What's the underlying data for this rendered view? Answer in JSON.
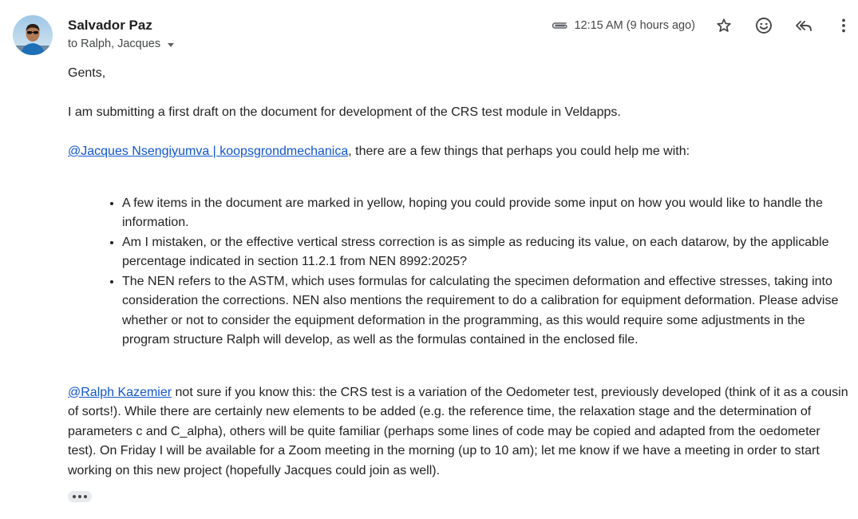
{
  "sender": {
    "name": "Salvador Paz",
    "recipients": "to Ralph, Jacques"
  },
  "meta": {
    "timestamp": "12:15 AM (9 hours ago)"
  },
  "icons": {
    "attachment": "paperclip-icon",
    "star": "star-icon",
    "emoji": "emoji-reaction-icon",
    "reply_all": "reply-all-icon",
    "more": "more-vert-icon",
    "caret": "chevron-down-icon",
    "expand": "ellipsis-icon"
  },
  "colors": {
    "link": "#1155cc",
    "text": "#222222",
    "secondary": "#444746",
    "icon": "#444746"
  },
  "body": {
    "greeting": "Gents,",
    "paragraph1": "I am submitting a first draft on the document for development of the CRS test module in Veldapps.",
    "mention1": "@Jacques Nsengiyumva | koopsgrondmechanica",
    "paragraph2_rest": ", there are a few things that perhaps you could help me with:",
    "bullets": [
      "A few items in the document are marked in yellow, hoping you could provide some input on how you would like to handle the information.",
      "Am I mistaken, or the effective vertical stress correction is as simple as reducing its value, on each datarow, by the applicable percentage indicated in section 11.2.1 from NEN 8992:2025?",
      "The NEN refers to the ASTM, which uses formulas for calculating the specimen deformation and effective stresses, taking into consideration the corrections. NEN also mentions the requirement to do a calibration for equipment deformation. Please advise whether or not to consider the equipment deformation in the programming, as this would require some adjustments in the program structure Ralph will develop, as well as the formulas contained in the enclosed file."
    ],
    "mention2": "@Ralph Kazemier",
    "paragraph3_rest": " not sure if you know this: the CRS test is a variation of the Oedometer test, previously developed (think of it as a cousin of sorts!). While there are certainly new elements to be added (e.g. the reference time, the relaxation stage and the determination of parameters c and C_alpha), others will be quite familiar (perhaps some lines of code may be copied and adapted from the oedometer test). On Friday I will be available for a Zoom meeting in the morning (up to 10 am); let me know if we have a meeting in order to start working on this new project (hopefully Jacques could join as well)."
  }
}
